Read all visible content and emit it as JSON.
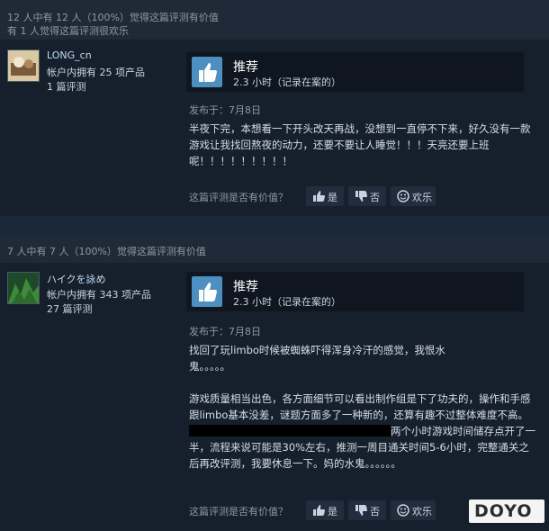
{
  "reviews": [
    {
      "helpful_summary": "12 人中有 12 人（100%）觉得这篇评测有价值",
      "funny_summary": "有 1 人觉得这篇评测很欢乐",
      "author": {
        "name": "LONG_cn",
        "products": "帐户内拥有 25 项产品",
        "reviews": "1 篇评测"
      },
      "verdict": "推荐",
      "hours": "2.3 小时（记录在案的）",
      "posted": "发布于：7月8日",
      "body": [
        "半夜下完，本想看一下开头改天再战，没想到一直停不下来，好久没有一款游戏让我找回熬夜的动力，还要不要让人睡觉！！！天亮还要上班呢！！！！！！！！！"
      ],
      "vote": {
        "question": "这篇评测是否有价值？",
        "yes": "是",
        "no": "否",
        "funny": "欢乐"
      }
    },
    {
      "helpful_summary": "7 人中有 7 人（100%）觉得这篇评测有价值",
      "author": {
        "name": "ハイクを詠め",
        "products": "帐户内拥有 343 项产品",
        "reviews": "27 篇评测"
      },
      "verdict": "推荐",
      "hours": "2.3 小时（记录在案的）",
      "posted": "发布于：7月8日",
      "body_p1": "找回了玩limbo时候被蜘蛛吓得浑身冷汗的感觉，我恨水鬼。。。。。",
      "body_p2a": "游戏质量相当出色，各方面细节可以看出制作组是下了功夫的，操作和手感跟limbo基本没差，谜题方面多了一种新的，还算有趣不过整体难度不高。",
      "body_p2b": "两个小时游戏时间储存点开了一半，流程来说可能是30%左右，推测一周目通关时间5-6小时，完整通关之后再改评测，我要休息一下。妈的水鬼。。。。。。",
      "vote": {
        "question": "这篇评测是否有价值？",
        "yes": "是",
        "no": "否",
        "funny": "欢乐"
      }
    }
  ],
  "watermark": "DOYO",
  "colors": {
    "accent": "#4c8fc0",
    "background": "#1b2838",
    "panel": "#16202d"
  }
}
